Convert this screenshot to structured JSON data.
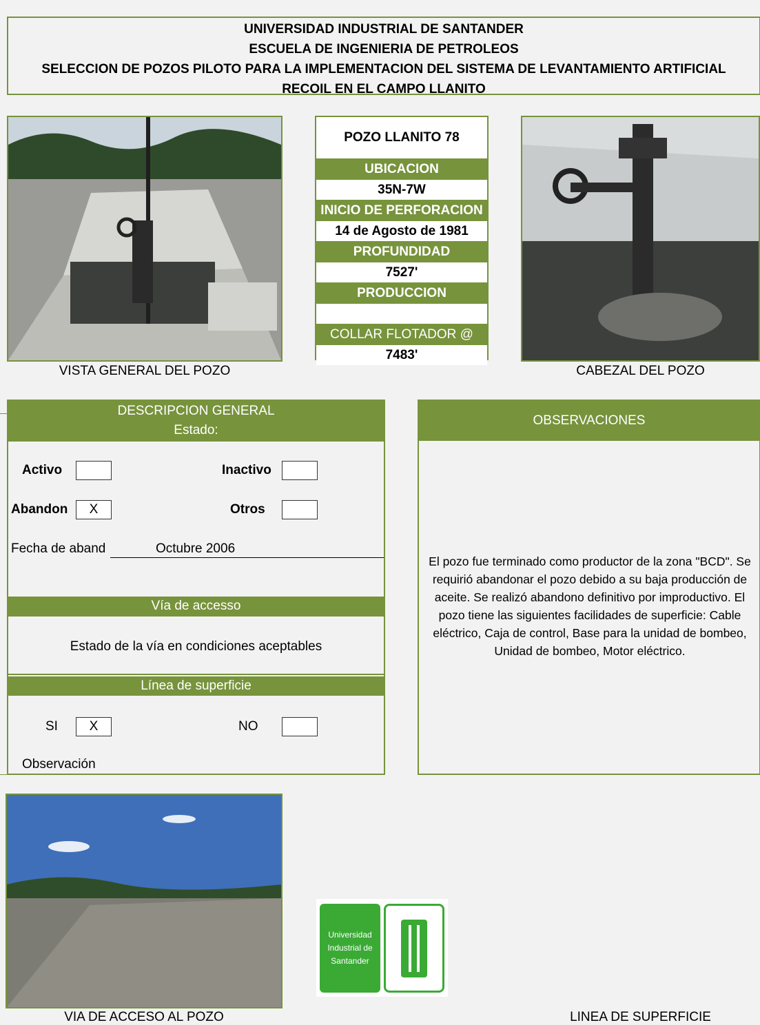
{
  "header": {
    "line1": "UNIVERSIDAD INDUSTRIAL DE SANTANDER",
    "line2": "ESCUELA DE INGENIERIA DE PETROLEOS",
    "line3": "SELECCION DE POZOS PILOTO PARA LA IMPLEMENTACION DEL SISTEMA DE LEVANTAMIENTO ARTIFICIAL",
    "line4": "RECOIL EN EL CAMPO LLANITO"
  },
  "photos": {
    "vista_caption": "VISTA GENERAL DEL POZO",
    "cabezal_caption": "CABEZAL DEL POZO",
    "via_caption": "VIA DE ACCESO AL POZO",
    "linea_caption": "LINEA DE SUPERFICIE"
  },
  "well": {
    "title": "POZO LLANITO 78",
    "ubicacion_label": "UBICACION",
    "ubicacion": "35N-7W",
    "inicio_label": "INICIO DE PERFORACION",
    "inicio": "14 de Agosto de 1981",
    "profundidad_label": "PROFUNDIDAD",
    "profundidad": "7527'",
    "produccion_label": "PRODUCCION",
    "produccion": "",
    "collar_label": "COLLAR FLOTADOR @",
    "collar": "7483'"
  },
  "descripcion": {
    "title": "DESCRIPCION GENERAL",
    "estado_label": "Estado:",
    "activo_label": "Activo",
    "activo_value": "",
    "inactivo_label": "Inactivo",
    "inactivo_value": "",
    "abandon_label": "Abandon",
    "abandon_value": "X",
    "otros_label": "Otros",
    "otros_value": "",
    "fecha_label": "Fecha de aband",
    "fecha_value": "Octubre 2006",
    "via_title": "Vía de accesso",
    "via_text": "Estado de la vía en condiciones aceptables",
    "linea_title": "Línea de superficie",
    "si_label": "SI",
    "si_value": "X",
    "no_label": "NO",
    "no_value": "",
    "observacion_label": "Observación"
  },
  "observaciones": {
    "title": "OBSERVACIONES",
    "text": "El pozo fue terminado como productor de la zona \"BCD\". Se requirió abandonar el pozo debido a su baja producción de aceite. Se realizó abandono definitivo por improductivo. El pozo tiene las siguientes facilidades de superficie: Cable eléctrico, Caja de control, Base para la unidad de bombeo, Unidad de bombeo, Motor eléctrico."
  },
  "logo": {
    "text_line1": "Universidad",
    "text_line2": "Industrial de",
    "text_line3": "Santander",
    "mark": "UIS",
    "color": "#3aaa35"
  }
}
